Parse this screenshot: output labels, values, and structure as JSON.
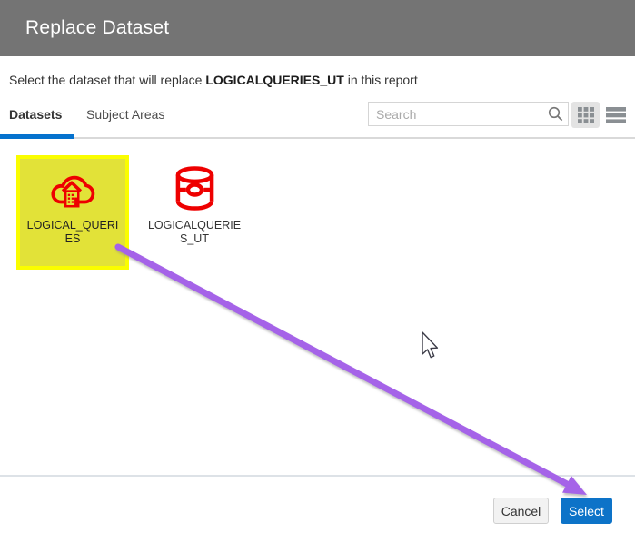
{
  "dialog": {
    "title": "Replace Dataset",
    "message": {
      "prefix": "Select the dataset that will replace ",
      "dataset_name": "LOGICALQUERIES_UT",
      "suffix": " in this report"
    },
    "tabs": [
      {
        "label": "Datasets",
        "active": true
      },
      {
        "label": "Subject Areas",
        "active": false
      }
    ],
    "search": {
      "placeholder": "Search",
      "value": ""
    },
    "view_toggle": {
      "selected": "grid"
    },
    "datasets": [
      {
        "name": "LOGICAL_QUERIES",
        "label_display": "LOGICAL_QUERI\nES",
        "icon": "cloud-dataset-icon",
        "highlighted": true
      },
      {
        "name": "LOGICALQUERIES_UT",
        "label_display": "LOGICALQUERIE\nS_UT",
        "icon": "database-dataset-icon",
        "highlighted": false
      }
    ],
    "footer": {
      "cancel_label": "Cancel",
      "select_label": "Select"
    }
  },
  "annotations": {
    "highlight_fill": "#e2e238",
    "highlight_border": "#fafd00",
    "arrow_color": "#a563e8",
    "arrow_from": "LOGICAL_QUERIES tile",
    "arrow_to": "Select button"
  },
  "icons": {
    "search": "search-icon",
    "grid_view": "grid-view-icon",
    "list_view": "list-view-icon",
    "dataset_cloud": "cloud-dataset-icon",
    "dataset_database": "database-dataset-icon",
    "mouse": "mouse-cursor"
  },
  "colors": {
    "header_bg": "#747474",
    "accent_blue": "#0572ce",
    "icon_red": "#ee0000",
    "select_button": "#0d73c8"
  }
}
